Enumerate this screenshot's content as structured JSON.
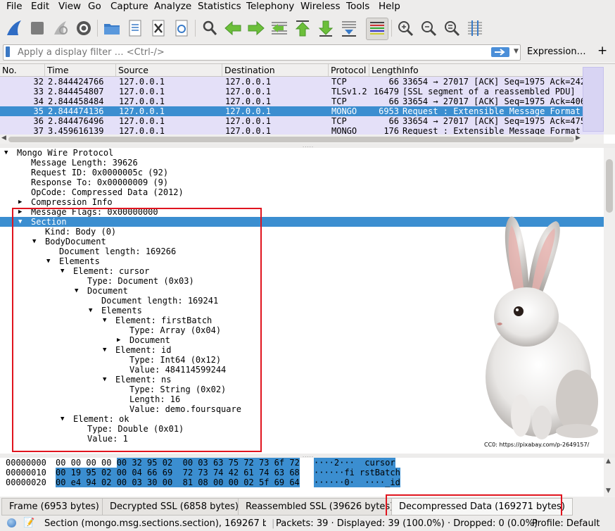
{
  "menu": [
    "File",
    "Edit",
    "View",
    "Go",
    "Capture",
    "Analyze",
    "Statistics",
    "Telephony",
    "Wireless",
    "Tools",
    "Help"
  ],
  "toolbar_icons": [
    "shark-fin-start-icon",
    "stop-icon",
    "restart-icon",
    "options-gear-icon",
    "open-folder-icon",
    "save-file-icon",
    "close-file-icon",
    "reload-file-icon",
    "find-icon",
    "go-back-icon",
    "go-forward-icon",
    "go-to-packet-icon",
    "first-packet-icon",
    "last-packet-icon",
    "autoscroll-icon",
    "colorize-icon",
    "zoom-in-icon",
    "zoom-out-icon",
    "normal-size-icon",
    "resize-columns-icon"
  ],
  "filter": {
    "placeholder": "Apply a display filter … <Ctrl-/>",
    "expression_label": "Expression…",
    "add_label": "+"
  },
  "packet_list": {
    "columns": [
      "No.",
      "Time",
      "Source",
      "Destination",
      "Protocol",
      "Length",
      "Info"
    ],
    "rows": [
      {
        "no": "32",
        "time": "2.844424766",
        "src": "127.0.0.1",
        "dst": "127.0.0.1",
        "proto": "TCP",
        "len": "66",
        "info": "33654 → 27017 [ACK] Seq=1975 Ack=242",
        "selected": false
      },
      {
        "no": "33",
        "time": "2.844454807",
        "src": "127.0.0.1",
        "dst": "127.0.0.1",
        "proto": "TLSv1.2",
        "len": "16479",
        "info": "[SSL segment of a reassembled PDU]",
        "selected": false
      },
      {
        "no": "34",
        "time": "2.844458484",
        "src": "127.0.0.1",
        "dst": "127.0.0.1",
        "proto": "TCP",
        "len": "66",
        "info": "33654 → 27017 [ACK] Seq=1975 Ack=406",
        "selected": false
      },
      {
        "no": "35",
        "time": "2.844474136",
        "src": "127.0.0.1",
        "dst": "127.0.0.1",
        "proto": "MONGO",
        "len": "6953",
        "info": "Request : Extensible Message Format",
        "selected": true
      },
      {
        "no": "36",
        "time": "2.844476496",
        "src": "127.0.0.1",
        "dst": "127.0.0.1",
        "proto": "TCP",
        "len": "66",
        "info": "33654 → 27017 [ACK] Seq=1975 Ack=475",
        "selected": false
      },
      {
        "no": "37",
        "time": "3.459616139",
        "src": "127.0.0.1",
        "dst": "127.0.0.1",
        "proto": "MONGO",
        "len": "176",
        "info": "Request : Extensible Message Format",
        "selected": false
      }
    ]
  },
  "details": [
    {
      "text": "Mongo Wire Protocol",
      "depth": 0,
      "arrow": "open",
      "selected": false
    },
    {
      "text": "Message Length: 39626",
      "depth": 1,
      "arrow": "none",
      "selected": false
    },
    {
      "text": "Request ID: 0x0000005c (92)",
      "depth": 1,
      "arrow": "none",
      "selected": false
    },
    {
      "text": "Response To: 0x00000009 (9)",
      "depth": 1,
      "arrow": "none",
      "selected": false
    },
    {
      "text": "OpCode: Compressed Data (2012)",
      "depth": 1,
      "arrow": "none",
      "selected": false
    },
    {
      "text": "Compression Info",
      "depth": 1,
      "arrow": "closed",
      "selected": false
    },
    {
      "text": "Message Flags: 0x00000000",
      "depth": 1,
      "arrow": "closed",
      "selected": false
    },
    {
      "text": "Section",
      "depth": 1,
      "arrow": "open",
      "selected": true
    },
    {
      "text": "Kind: Body (0)",
      "depth": 2,
      "arrow": "none",
      "selected": false
    },
    {
      "text": "BodyDocument",
      "depth": 2,
      "arrow": "open",
      "selected": false
    },
    {
      "text": "Document length: 169266",
      "depth": 3,
      "arrow": "none",
      "selected": false
    },
    {
      "text": "Elements",
      "depth": 3,
      "arrow": "open",
      "selected": false
    },
    {
      "text": "Element: cursor",
      "depth": 4,
      "arrow": "open",
      "selected": false
    },
    {
      "text": "Type: Document (0x03)",
      "depth": 5,
      "arrow": "none",
      "selected": false
    },
    {
      "text": "Document",
      "depth": 5,
      "arrow": "open",
      "selected": false
    },
    {
      "text": "Document length: 169241",
      "depth": 6,
      "arrow": "none",
      "selected": false
    },
    {
      "text": "Elements",
      "depth": 6,
      "arrow": "open",
      "selected": false
    },
    {
      "text": "Element: firstBatch",
      "depth": 7,
      "arrow": "open",
      "selected": false
    },
    {
      "text": "Type: Array (0x04)",
      "depth": 8,
      "arrow": "none",
      "selected": false
    },
    {
      "text": "Document",
      "depth": 8,
      "arrow": "closed",
      "selected": false
    },
    {
      "text": "Element: id",
      "depth": 7,
      "arrow": "open",
      "selected": false
    },
    {
      "text": "Type: Int64 (0x12)",
      "depth": 8,
      "arrow": "none",
      "selected": false
    },
    {
      "text": "Value: 484114599244",
      "depth": 8,
      "arrow": "none",
      "selected": false
    },
    {
      "text": "Element: ns",
      "depth": 7,
      "arrow": "open",
      "selected": false
    },
    {
      "text": "Type: String (0x02)",
      "depth": 8,
      "arrow": "none",
      "selected": false
    },
    {
      "text": "Length: 16",
      "depth": 8,
      "arrow": "none",
      "selected": false
    },
    {
      "text": "Value: demo.foursquare",
      "depth": 8,
      "arrow": "none",
      "selected": false
    },
    {
      "text": "Element: ok",
      "depth": 4,
      "arrow": "open",
      "selected": false
    },
    {
      "text": "Type: Double (0x01)",
      "depth": 5,
      "arrow": "none",
      "selected": false
    },
    {
      "text": "Value: 1",
      "depth": 5,
      "arrow": "none",
      "selected": false
    }
  ],
  "image_credit": "CC0: https://pixabay.com/p-2649157/",
  "bytes": [
    {
      "offset": "00000000",
      "hex_plain": "00 00 00 00 ",
      "hex_hl": "00 32 95 02  00 03 63 75 72 73 6f 72",
      "ascii_hl": "····2···  cursor"
    },
    {
      "offset": "00000010",
      "hex_plain": "",
      "hex_hl": "00 19 95 02 00 04 66 69  72 73 74 42 61 74 63 68",
      "ascii_hl": "······fi rstBatch"
    },
    {
      "offset": "00000020",
      "hex_plain": "",
      "hex_hl": "00 e4 94 02 00 03 30 00  81 08 00 00 02 5f 69 64",
      "ascii_hl": "······0·  ····_id"
    }
  ],
  "tabs": [
    "Frame (6953 bytes)",
    "Decrypted SSL (6858 bytes)",
    "Reassembled SSL (39626 bytes)",
    "Decompressed Data (169271 bytes)"
  ],
  "status": {
    "field": "Section (mongo.msg.sections.section), 169267 byte",
    "packets": "Packets: 39 · Displayed: 39 (100.0%) · Dropped: 0 (0.0%)",
    "profile": "Profile: Default"
  },
  "colors": {
    "selection": "#3b8ed0",
    "row_tint": "#e4e0f8",
    "highlight_box": "#e0141e"
  }
}
